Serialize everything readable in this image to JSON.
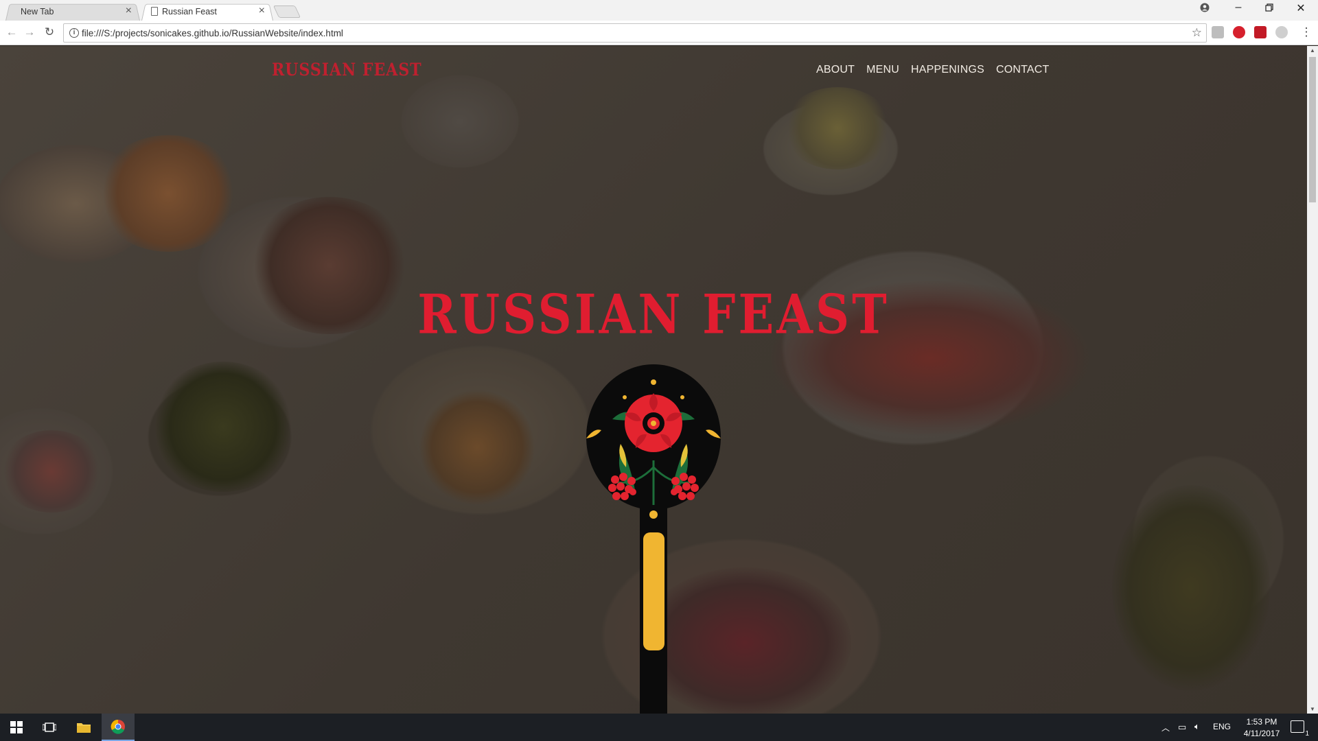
{
  "browser": {
    "tabs": [
      {
        "title": "New Tab",
        "active": false
      },
      {
        "title": "Russian Feast",
        "active": true
      }
    ],
    "url": "file:///S:/projects/sonicakes.github.io/RussianWebsite/index.html"
  },
  "site": {
    "logo": "RUSSIAN FEAST",
    "nav": [
      "ABOUT",
      "MENU",
      "HAPPENINGS",
      "CONTACT"
    ],
    "hero_title": "RUSSIAN FEAST"
  },
  "taskbar": {
    "language": "ENG",
    "time": "1:53 PM",
    "date": "4/11/2017",
    "notification_count": "1"
  },
  "colors": {
    "brand_red": "#e01d30",
    "spoon_yellow": "#f0b531",
    "nav_text": "#f2ece4"
  }
}
